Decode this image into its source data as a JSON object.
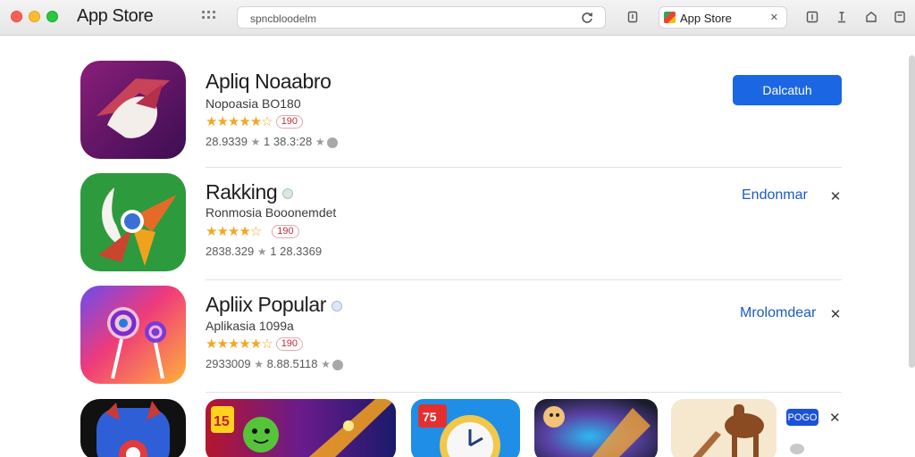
{
  "window": {
    "title": "App Store"
  },
  "toolbar": {
    "url": "spncbloodelm",
    "tab_label": "App Store"
  },
  "apps": [
    {
      "name": "Apliq Noaabro",
      "subtitle": "Nopoasia  BO180",
      "stars": "★★★★★☆",
      "rating_badge": "190",
      "stats_a": "28.9339",
      "stats_b": "1 38.3:28",
      "action": "Dalcatuh",
      "action_style": "primary"
    },
    {
      "name": "Rakking",
      "subtitle": "Ronmosia Booonemdet",
      "stars": "★★★★☆",
      "rating_badge": "190",
      "stats_a": "2838.329",
      "stats_b": "1 28.3369",
      "action": "Endonmar",
      "action_style": "link"
    },
    {
      "name": "Apliix Popular",
      "subtitle": "Aplikasia 1099a",
      "stars": "★★★★★☆",
      "rating_badge": "190",
      "stats_a": "2933009",
      "stats_b": "8.88.5118",
      "action": "Mrolomdear",
      "action_style": "link"
    }
  ],
  "shelf": {
    "badge": "POGO",
    "game_label": "15",
    "tile_label": "75"
  },
  "colors": {
    "accent": "#1b66e3",
    "link": "#1b5ac8",
    "star": "#f5a623"
  },
  "icons": [
    "reload-icon",
    "share-icon",
    "upload-icon",
    "close-icon",
    "star-icon"
  ]
}
